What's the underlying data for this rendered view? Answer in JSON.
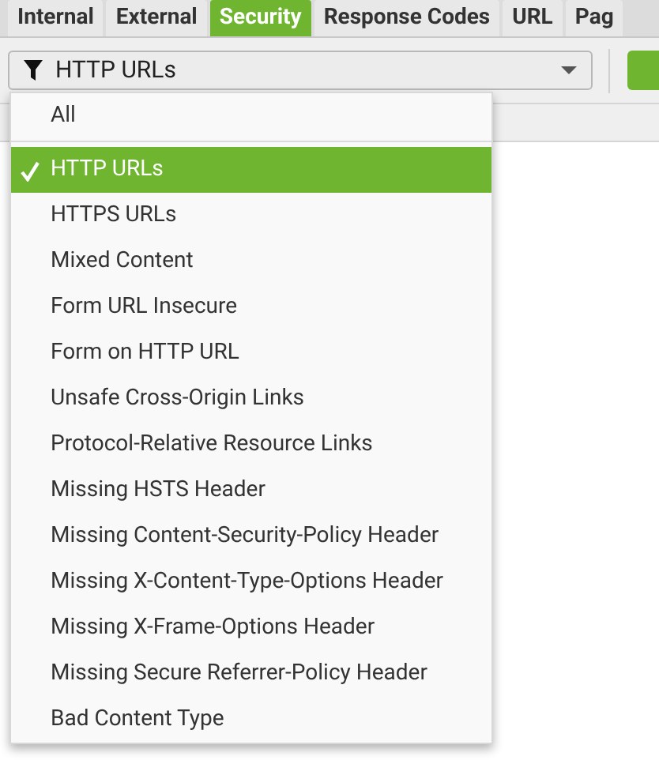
{
  "tabs": [
    {
      "label": "Internal",
      "selected": false
    },
    {
      "label": "External",
      "selected": false
    },
    {
      "label": "Security",
      "selected": true
    },
    {
      "label": "Response Codes",
      "selected": false
    },
    {
      "label": "URL",
      "selected": false
    },
    {
      "label": "Pag",
      "selected": false
    }
  ],
  "filter": {
    "value": "HTTP URLs"
  },
  "menu": {
    "items": [
      {
        "label": "All",
        "selected": false
      },
      {
        "label": "HTTP URLs",
        "selected": true
      },
      {
        "label": "HTTPS URLs",
        "selected": false
      },
      {
        "label": "Mixed Content",
        "selected": false
      },
      {
        "label": "Form URL Insecure",
        "selected": false
      },
      {
        "label": "Form on HTTP URL",
        "selected": false
      },
      {
        "label": "Unsafe Cross-Origin Links",
        "selected": false
      },
      {
        "label": "Protocol-Relative Resource Links",
        "selected": false
      },
      {
        "label": "Missing HSTS Header",
        "selected": false
      },
      {
        "label": "Missing Content-Security-Policy Header",
        "selected": false
      },
      {
        "label": "Missing X-Content-Type-Options Header",
        "selected": false
      },
      {
        "label": "Missing X-Frame-Options Header",
        "selected": false
      },
      {
        "label": "Missing Secure Referrer-Policy Header",
        "selected": false
      },
      {
        "label": "Bad Content Type",
        "selected": false
      }
    ]
  }
}
